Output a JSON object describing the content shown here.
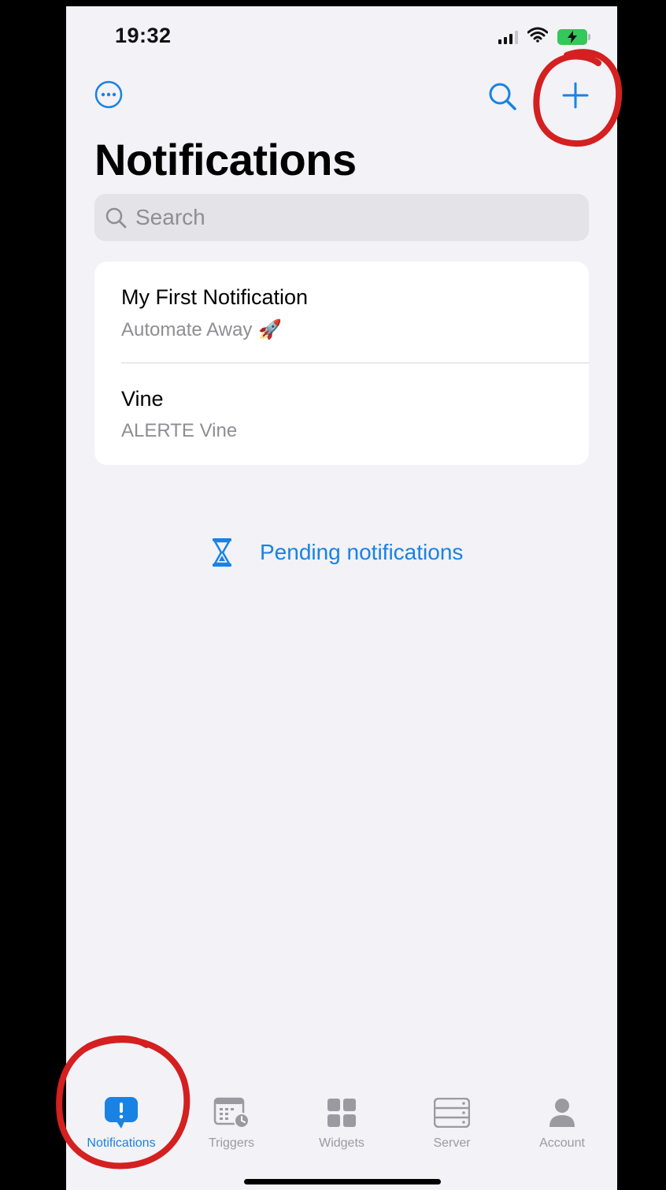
{
  "status_bar": {
    "time": "19:32"
  },
  "nav": {
    "more_icon": "ellipsis-circle-icon",
    "search_icon": "magnifier-icon",
    "add_icon": "plus-icon",
    "title": "Notifications"
  },
  "search": {
    "placeholder": "Search"
  },
  "notifications": [
    {
      "title": "My First Notification",
      "subtitle": "Automate Away",
      "emoji": "🚀"
    },
    {
      "title": "Vine",
      "subtitle": "ALERTE Vine",
      "emoji": ""
    }
  ],
  "pending": {
    "label": "Pending notifications",
    "icon": "hourglass-icon"
  },
  "tabs": [
    {
      "label": "Notifications",
      "icon": "exclamation-bubble-icon",
      "active": true
    },
    {
      "label": "Triggers",
      "icon": "calendar-clock-icon",
      "active": false
    },
    {
      "label": "Widgets",
      "icon": "grid-icon",
      "active": false
    },
    {
      "label": "Server",
      "icon": "server-icon",
      "active": false
    },
    {
      "label": "Account",
      "icon": "person-icon",
      "active": false
    }
  ],
  "colors": {
    "accent": "#1a82e2",
    "annotation": "#d42020",
    "background": "#f2f2f7",
    "battery": "#34c759"
  }
}
